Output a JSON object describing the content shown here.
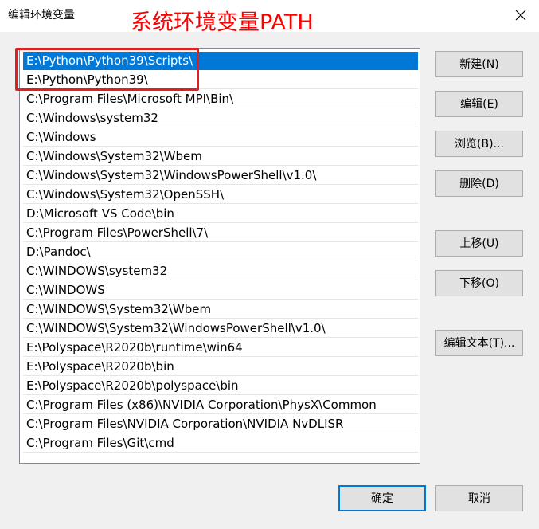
{
  "window": {
    "title": "编辑环境变量",
    "close_icon": "close-icon"
  },
  "annotation": {
    "text": "系统环境变量PATH",
    "color": "#ff0000"
  },
  "list": {
    "items": [
      "E:\\Python\\Python39\\Scripts\\",
      "E:\\Python\\Python39\\",
      "C:\\Program Files\\Microsoft MPI\\Bin\\",
      "C:\\Windows\\system32",
      "C:\\Windows",
      "C:\\Windows\\System32\\Wbem",
      "C:\\Windows\\System32\\WindowsPowerShell\\v1.0\\",
      "C:\\Windows\\System32\\OpenSSH\\",
      "D:\\Microsoft VS Code\\bin",
      "C:\\Program Files\\PowerShell\\7\\",
      "D:\\Pandoc\\",
      "C:\\WINDOWS\\system32",
      "C:\\WINDOWS",
      "C:\\WINDOWS\\System32\\Wbem",
      "C:\\WINDOWS\\System32\\WindowsPowerShell\\v1.0\\",
      "E:\\Polyspace\\R2020b\\runtime\\win64",
      "E:\\Polyspace\\R2020b\\bin",
      "E:\\Polyspace\\R2020b\\polyspace\\bin",
      "C:\\Program Files (x86)\\NVIDIA Corporation\\PhysX\\Common",
      "C:\\Program Files\\NVIDIA Corporation\\NVIDIA NvDLISR",
      "C:\\Program Files\\Git\\cmd"
    ],
    "selected_index": 0,
    "selection_color": "#0078d7"
  },
  "buttons": {
    "new": "新建(N)",
    "edit": "编辑(E)",
    "browse": "浏览(B)...",
    "delete": "删除(D)",
    "move_up": "上移(U)",
    "move_down": "下移(O)",
    "edit_text": "编辑文本(T)...",
    "ok": "确定",
    "cancel": "取消"
  }
}
